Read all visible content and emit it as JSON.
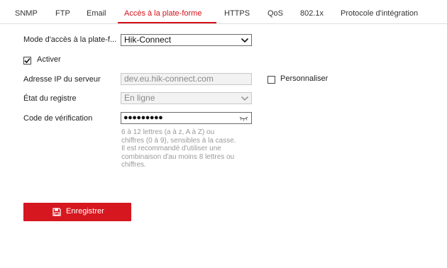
{
  "tabs": [
    {
      "label": "SNMP"
    },
    {
      "label": "FTP"
    },
    {
      "label": "Email"
    },
    {
      "label": "Accès à la plate-forme",
      "active": true
    },
    {
      "label": "HTTPS"
    },
    {
      "label": "QoS"
    },
    {
      "label": "802.1x"
    },
    {
      "label": "Protocole d'intégration"
    }
  ],
  "form": {
    "mode_label": "Mode d'accès à la plate-f...",
    "mode_value": "Hik-Connect",
    "enable_label": "Activer",
    "enable_checked": true,
    "server_ip_label": "Adresse IP du serveur",
    "server_ip_value": "dev.eu.hik-connect.com",
    "custom_label": "Personnaliser",
    "custom_checked": false,
    "register_status_label": "État du registre",
    "register_status_value": "En ligne",
    "verification_code_label": "Code de vérification",
    "verification_code_mask": "●●●●●●●●●",
    "hint_lines": [
      "6 à 12 lettres (a à z, A à Z) ou",
      "chiffres (0 à 9), sensibles à la casse.",
      "Il est recommandé d'utiliser une",
      "combinaison d'au moins 8 lettres ou",
      "chiffres."
    ]
  },
  "actions": {
    "save_label": "Enregistrer"
  },
  "colors": {
    "accent": "#d6171f",
    "active_tab": "#d4111a",
    "disabled_text": "#8a8a8a",
    "hint_text": "#9a9a9a"
  },
  "icons": {
    "chevron": "chevron-down-icon",
    "check": "check-icon",
    "eye": "eye-closed-icon",
    "save": "floppy-disk-icon"
  }
}
